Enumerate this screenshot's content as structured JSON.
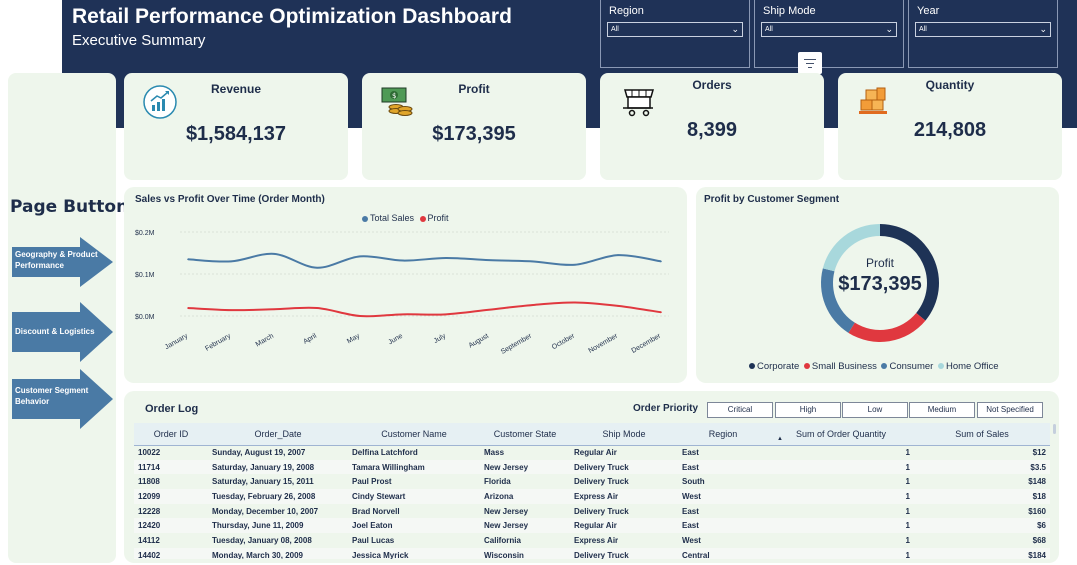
{
  "header": {
    "title": "Retail Performance Optimization Dashboard",
    "subtitle": "Executive Summary"
  },
  "slicers": [
    {
      "label": "Region",
      "value": "All"
    },
    {
      "label": "Ship Mode",
      "value": "All"
    },
    {
      "label": "Year",
      "value": "All"
    }
  ],
  "kpis": {
    "revenue": {
      "label": "Revenue",
      "value": "$1,584,137",
      "icon": "growth-chart-icon"
    },
    "profit": {
      "label": "Profit",
      "value": "$173,395",
      "icon": "money-stack-icon"
    },
    "orders": {
      "label": "Orders",
      "value": "8,399",
      "icon": "store-cart-icon"
    },
    "quantity": {
      "label": "Quantity",
      "value": "214,808",
      "icon": "boxes-icon"
    }
  },
  "sidebar": {
    "title": "Page Button",
    "buttons": [
      {
        "label": "Geography & Product Performance"
      },
      {
        "label": "Discount & Logistics"
      },
      {
        "label": "Customer Segment Behavior"
      }
    ]
  },
  "line_chart": {
    "title": "Sales vs Profit Over Time (Order Month)",
    "legend": [
      "Total Sales",
      "Profit"
    ],
    "y_ticks": [
      "$0.2M",
      "$0.1M",
      "$0.0M"
    ]
  },
  "donut": {
    "title": "Profit by Customer Segment",
    "center_label": "Profit",
    "center_value": "$173,395",
    "legend": [
      "Corporate",
      "Small Business",
      "Consumer",
      "Home Office"
    ]
  },
  "chart_data": [
    {
      "type": "line",
      "title": "Sales vs Profit Over Time (Order Month)",
      "x": [
        "January",
        "February",
        "March",
        "April",
        "May",
        "June",
        "July",
        "August",
        "September",
        "October",
        "November",
        "December"
      ],
      "ylim": [
        0,
        0.2
      ],
      "series": [
        {
          "name": "Total Sales",
          "color": "#4a7aa5",
          "values": [
            0.135,
            0.13,
            0.148,
            0.115,
            0.142,
            0.132,
            0.138,
            0.133,
            0.13,
            0.122,
            0.145,
            0.13
          ]
        },
        {
          "name": "Profit",
          "color": "#e0383f",
          "values": [
            0.019,
            0.014,
            0.016,
            0.019,
            0.0,
            0.004,
            0.004,
            0.015,
            0.026,
            0.032,
            0.024,
            0.009
          ]
        }
      ]
    },
    {
      "type": "pie",
      "title": "Profit by Customer Segment",
      "categories": [
        "Corporate",
        "Small Business",
        "Consumer",
        "Home Office"
      ],
      "colors": [
        "#1e3356",
        "#e0383f",
        "#4a7aa5",
        "#a8d8dc"
      ],
      "values": [
        0.36,
        0.23,
        0.2,
        0.21
      ]
    }
  ],
  "order_log": {
    "title": "Order Log",
    "priority_label": "Order Priority",
    "priorities": [
      "Critical",
      "High",
      "Low",
      "Medium",
      "Not Specified"
    ],
    "columns": [
      "Order ID",
      "Order_Date",
      "Customer Name",
      "Customer State",
      "Ship Mode",
      "Region",
      "Sum of Order Quantity",
      "Sum of Sales"
    ],
    "rows": [
      [
        "10022",
        "Sunday, August 19, 2007",
        "Delfina Latchford",
        "Mass",
        "Regular Air",
        "East",
        "1",
        "$12"
      ],
      [
        "11714",
        "Saturday, January 19, 2008",
        "Tamara Willingham",
        "New Jersey",
        "Delivery Truck",
        "East",
        "1",
        "$3.5"
      ],
      [
        "11808",
        "Saturday, January 15, 2011",
        "Paul Prost",
        "Florida",
        "Delivery Truck",
        "South",
        "1",
        "$148"
      ],
      [
        "12099",
        "Tuesday, February 26, 2008",
        "Cindy Stewart",
        "Arizona",
        "Express Air",
        "West",
        "1",
        "$18"
      ],
      [
        "12228",
        "Monday, December 10, 2007",
        "Brad Norvell",
        "New Jersey",
        "Delivery Truck",
        "East",
        "1",
        "$160"
      ],
      [
        "12420",
        "Thursday, June 11, 2009",
        "Joel Eaton",
        "New Jersey",
        "Regular Air",
        "East",
        "1",
        "$6"
      ],
      [
        "14112",
        "Tuesday, January 08, 2008",
        "Paul Lucas",
        "California",
        "Express Air",
        "West",
        "1",
        "$68"
      ],
      [
        "14402",
        "Monday, March 30, 2009",
        "Jessica Myrick",
        "Wisconsin",
        "Delivery Truck",
        "Central",
        "1",
        "$184"
      ]
    ]
  }
}
